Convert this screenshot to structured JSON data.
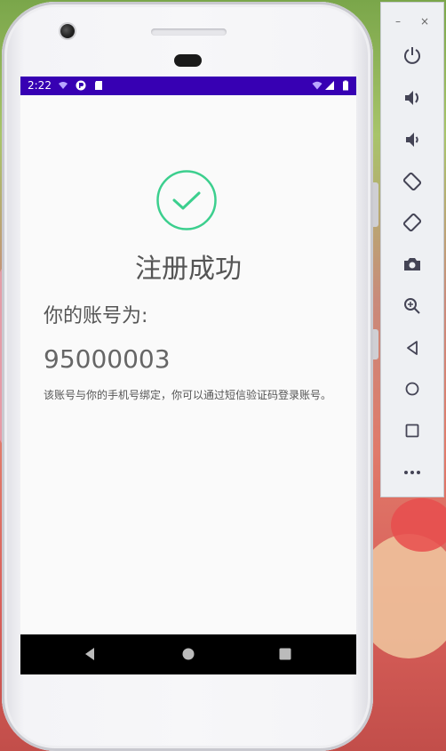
{
  "status_bar": {
    "time": "2:22"
  },
  "registration": {
    "title": "注册成功",
    "account_label": "你的账号为:",
    "account_number": "95000003",
    "note": "该账号与你的手机号绑定，你可以通过短信验证码登录账号。"
  },
  "toolbar": {
    "minimize_label": "–",
    "close_label": "×",
    "buttons": [
      "power-icon",
      "volume-up-icon",
      "volume-down-icon",
      "rotate-left-icon",
      "rotate-right-icon",
      "camera-icon",
      "zoom-icon",
      "back-icon",
      "home-icon",
      "overview-icon",
      "more-icon"
    ]
  },
  "colors": {
    "status_bar": "#3700b3",
    "accent_green": "#3ccf8e",
    "nav_bar": "#000000"
  }
}
